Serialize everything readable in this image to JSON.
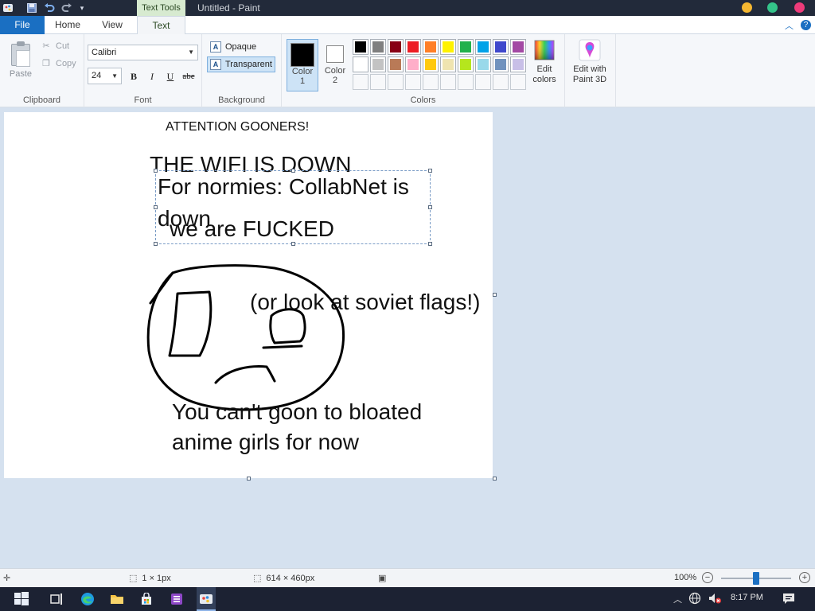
{
  "titlebar": {
    "title": "Untitled - Paint",
    "contextual_tab": "Text Tools",
    "icons": [
      "paint-app-icon",
      "save-icon",
      "undo-icon",
      "redo-icon",
      "customize-toolbar-icon"
    ],
    "window_buttons": [
      "minimize-button",
      "maximize-button",
      "close-button"
    ],
    "colors": {
      "minimize": "#f5b731",
      "maximize": "#34c38a",
      "close": "#ee3b7a"
    }
  },
  "tabs": [
    {
      "label": "File",
      "active": false
    },
    {
      "label": "Home",
      "active": false
    },
    {
      "label": "View",
      "active": false
    },
    {
      "label": "Text",
      "active": true
    }
  ],
  "ribbon": {
    "clipboard": {
      "label": "Clipboard",
      "paste": "Paste",
      "cut": "Cut",
      "copy": "Copy"
    },
    "font": {
      "label": "Font",
      "family": "Calibri",
      "size": "24",
      "bold": "B",
      "italic": "I",
      "underline": "U",
      "strike": "abe"
    },
    "background": {
      "label": "Background",
      "opaque": "Opaque",
      "transparent": "Transparent",
      "selected": "transparent"
    },
    "colors": {
      "label": "Colors",
      "color1": {
        "line1": "Color",
        "line2": "1",
        "value": "#000000"
      },
      "color2": {
        "line1": "Color",
        "line2": "2",
        "value": "#ffffff"
      },
      "palette_row1": [
        "#000000",
        "#7f7f7f",
        "#880015",
        "#ed1c24",
        "#ff7f27",
        "#fff200",
        "#22b14c",
        "#00a2e8",
        "#3f48cc",
        "#a349a4"
      ],
      "palette_row2": [
        "#ffffff",
        "#c3c3c3",
        "#b97a57",
        "#ffaec9",
        "#ffc90e",
        "#efe4b0",
        "#b5e61d",
        "#99d9ea",
        "#7092be",
        "#c8bfe7"
      ],
      "edit_colors": {
        "line1": "Edit",
        "line2": "colors"
      }
    },
    "paint3d": {
      "line1": "Edit with",
      "line2": "Paint 3D"
    }
  },
  "canvas": {
    "texts": {
      "attention": "ATTENTION GOONERS!",
      "wifi": "THE WIFI IS DOWN",
      "normies_line1": "For normies: CollabNet is",
      "normies_line2": "down",
      "fucked": "we are  FUCKED",
      "soviet": "(or look at soviet flags!)",
      "goon_line1": "You can't goon to bloated",
      "goon_line2": "anime girls for now"
    }
  },
  "statusbar": {
    "selection_size": "1 × 1px",
    "image_size": "614 × 460px",
    "zoom": "100%"
  },
  "taskbar": {
    "time": "8:17 PM",
    "icons": [
      "windows-start-icon",
      "task-view-icon",
      "edge-icon",
      "file-explorer-icon",
      "store-icon",
      "onenote-icon",
      "paint-taskbar-icon"
    ],
    "tray_icons": [
      "tray-chevron-icon",
      "network-icon",
      "volume-muted-icon",
      "notifications-icon"
    ]
  }
}
